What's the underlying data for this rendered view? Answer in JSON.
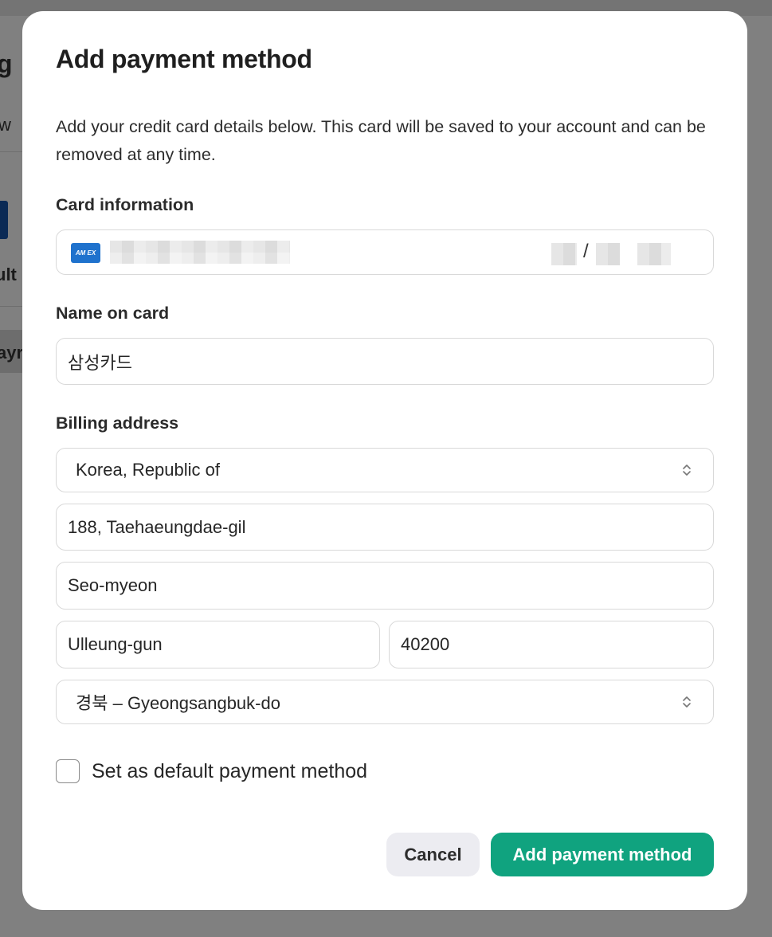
{
  "background": {
    "fragments": [
      "g",
      "w",
      "ult",
      "ayr"
    ]
  },
  "modal": {
    "title": "Add payment method",
    "description": "Add your credit card details below. This card will be saved to your account and can be removed at any time.",
    "card_section": {
      "label": "Card information",
      "card_brand_icon": "amex-card-icon",
      "card_brand_text": "AM EX",
      "expiry_separator": "/"
    },
    "name_section": {
      "label": "Name on card",
      "value": "삼성카드"
    },
    "billing_section": {
      "label": "Billing address",
      "country": "Korea, Republic of",
      "address_line1": "188, Taehaeungdae-gil",
      "address_line2": "Seo-myeon",
      "city": "Ulleung-gun",
      "postal_code": "40200",
      "province": "경북 – Gyeongsangbuk-do",
      "select_icon": "chevron-up-down-icon"
    },
    "default_checkbox": {
      "label": "Set as default payment method",
      "checked": false
    },
    "buttons": {
      "cancel": "Cancel",
      "submit": "Add payment method"
    }
  },
  "colors": {
    "primary": "#10a37f",
    "cancel_bg": "#ececf1",
    "overlay": "#808080",
    "amex_blue": "#1f72cd"
  }
}
